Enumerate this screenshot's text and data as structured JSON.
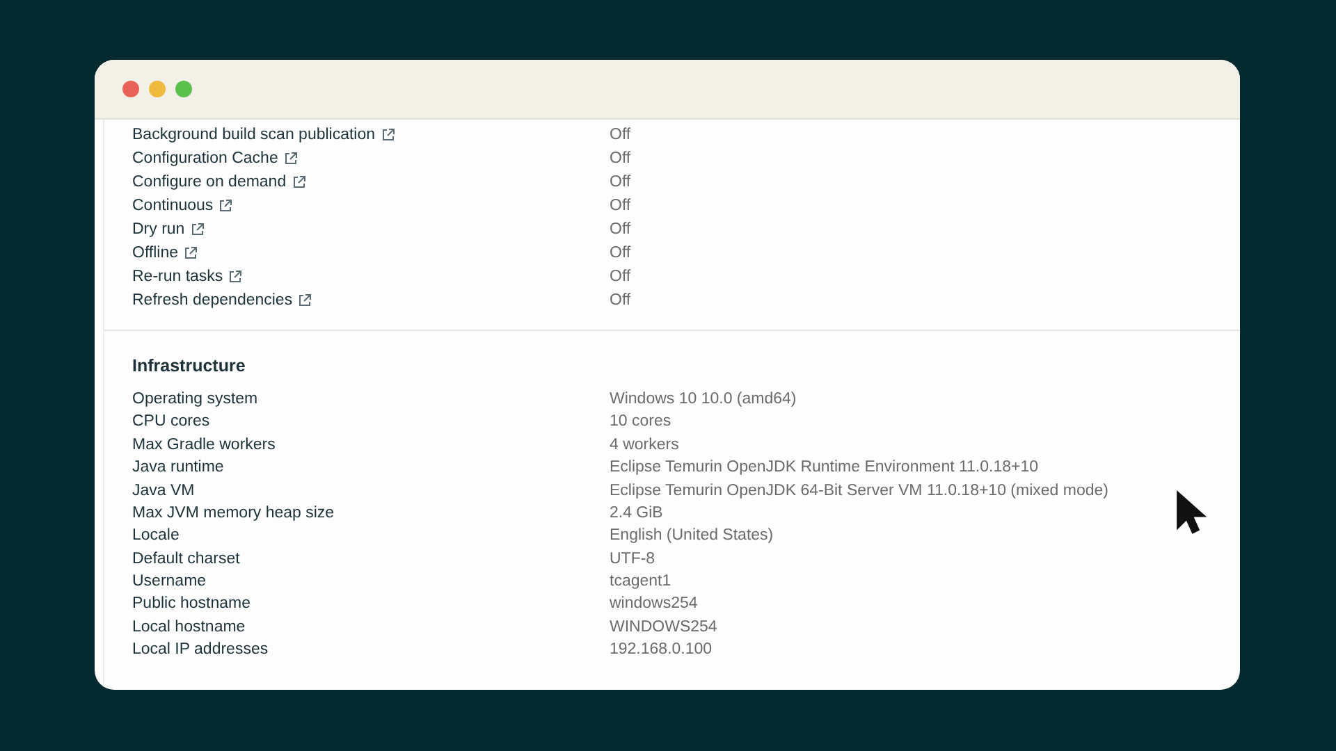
{
  "sections": [
    {
      "rows": [
        {
          "label": "Background build scan publication",
          "value": "Off",
          "kind": "link"
        },
        {
          "label": "Configuration Cache",
          "value": "Off",
          "kind": "link"
        },
        {
          "label": "Configure on demand",
          "value": "Off",
          "kind": "link"
        },
        {
          "label": "Continuous",
          "value": "Off",
          "kind": "link"
        },
        {
          "label": "Dry run",
          "value": "Off",
          "kind": "link"
        },
        {
          "label": "Offline",
          "value": "Off",
          "kind": "link"
        },
        {
          "label": "Re-run tasks",
          "value": "Off",
          "kind": "link"
        },
        {
          "label": "Refresh dependencies",
          "value": "Off",
          "kind": "link"
        }
      ]
    },
    {
      "title": "Infrastructure",
      "rows": [
        {
          "label": "Operating system",
          "value": "Windows 10 10.0 (amd64)",
          "kind": "plain"
        },
        {
          "label": "CPU cores",
          "value": "10 cores",
          "kind": "plain"
        },
        {
          "label": "Max Gradle workers",
          "value": "4 workers",
          "kind": "plain"
        },
        {
          "label": "Java runtime",
          "value": "Eclipse Temurin OpenJDK Runtime Environment 11.0.18+10",
          "kind": "plain"
        },
        {
          "label": "Java VM",
          "value": "Eclipse Temurin OpenJDK 64-Bit Server VM 11.0.18+10 (mixed mode)",
          "kind": "plain"
        },
        {
          "label": "Max JVM memory heap size",
          "value": "2.4 GiB",
          "kind": "plain"
        },
        {
          "label": "Locale",
          "value": "English (United States)",
          "kind": "plain"
        },
        {
          "label": "Default charset",
          "value": "UTF-8",
          "kind": "plain"
        },
        {
          "label": "Username",
          "value": "tcagent1",
          "kind": "plain"
        },
        {
          "label": "Public hostname",
          "value": "windows254",
          "kind": "plain"
        },
        {
          "label": "Local hostname",
          "value": "WINDOWS254",
          "kind": "plain"
        },
        {
          "label": "Local IP addresses",
          "value": "192.168.0.100",
          "kind": "plain"
        }
      ]
    }
  ]
}
